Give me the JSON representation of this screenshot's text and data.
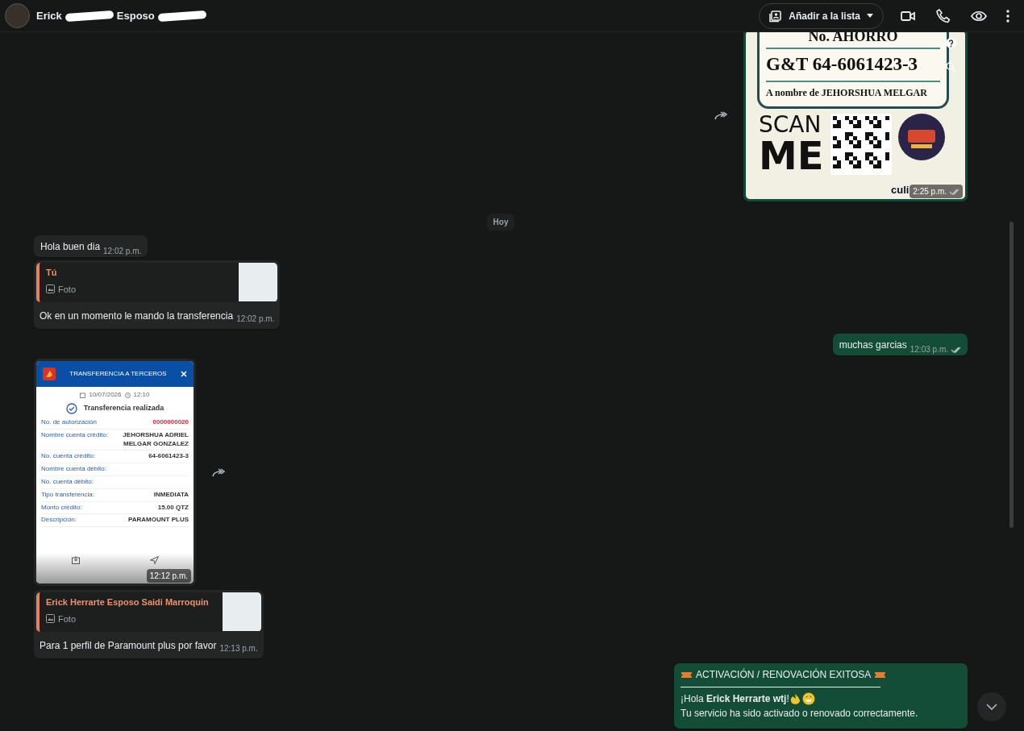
{
  "header": {
    "name_parts": [
      "Erick",
      "Esposo"
    ],
    "list_button": "Añadir a la lista"
  },
  "messages": [
    {
      "kind": "poster",
      "outgoing": true,
      "forward": true,
      "time": "2:25 p.m.",
      "read": false,
      "lines": [
        "No. AHORRO",
        "G&T 64-6061423-3",
        "A nombre de JEHORSHUA MELGAR",
        "SCAN",
        "ME",
        "culi"
      ]
    },
    {
      "kind": "date",
      "text": "Hoy"
    },
    {
      "kind": "text",
      "outgoing": false,
      "text": "Hola buen dia",
      "time": "12:02 p.m."
    },
    {
      "kind": "reply",
      "outgoing": false,
      "author": "Tú",
      "media": "Foto",
      "text": "Ok en un momento le mando la transferencia",
      "time": "12:02 p.m."
    },
    {
      "kind": "text",
      "outgoing": true,
      "text": "muchas garcias",
      "time": "12:03 p.m.",
      "read": false
    },
    {
      "kind": "receipt",
      "outgoing": false,
      "forward": true,
      "time": "12:12 p.m.",
      "receipt": {
        "title": "TRANSFERENCIA A TERCEROS",
        "date": "10/07/2026",
        "clock": "12:10",
        "status": "Transferencia realizada",
        "rows": [
          {
            "label": "No. de autorización",
            "value": "0000000020",
            "highlight": true
          },
          {
            "label": "Nombre cuenta crédito:",
            "value": "JEHORSHUA ADRIEL MELGAR GONZALEZ",
            "highlight": false
          },
          {
            "label": "No. cuenta crédito:",
            "value": "64-6061423-3",
            "highlight": false
          },
          {
            "label": "Nombre cuenta débito:",
            "highlight": false
          },
          {
            "label": "No. cuenta débito:",
            "highlight": false
          },
          {
            "label": "Tipo transferencia:",
            "value": "INMEDIATA",
            "highlight": false
          },
          {
            "label": "Monto crédito:",
            "value": "15.00 QTZ",
            "highlight": false
          },
          {
            "label": "Descripción:",
            "value": "PARAMOUNT PLUS",
            "highlight": false
          }
        ]
      }
    },
    {
      "kind": "reply",
      "outgoing": false,
      "author": "Erick Herrarte Esposo Saidi Marroquin",
      "media": "Foto",
      "text": "Para 1 perfil de Paramount plus por favor",
      "time": "12:13 p.m."
    },
    {
      "kind": "notice",
      "outgoing": true,
      "title": "ACTIVACIÓN / RENOVACIÓN EXITOSA",
      "greeting": "¡Hola **Erick Herrarte wtj**!",
      "body": "Tu servicio ha sido activado o renovado correctamente."
    }
  ]
}
